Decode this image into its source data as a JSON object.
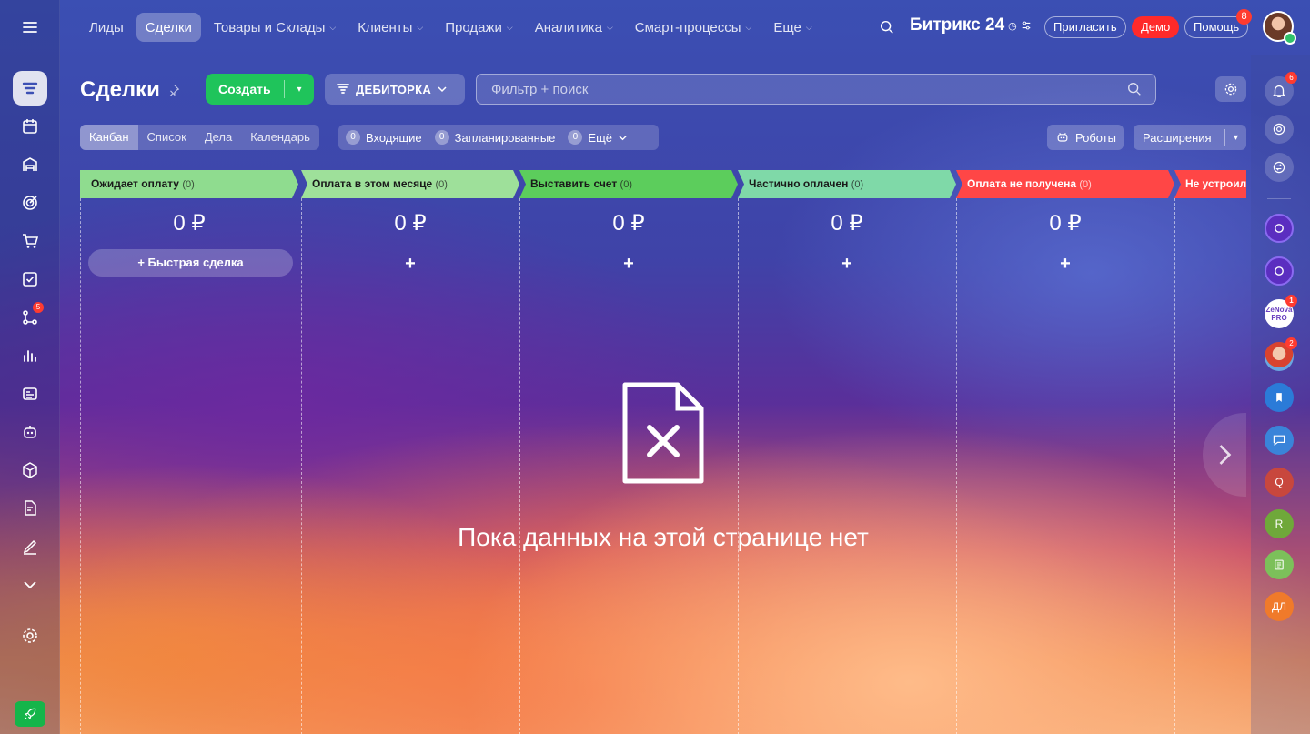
{
  "nav": {
    "items": [
      {
        "label": "Лиды",
        "dropdown": false
      },
      {
        "label": "Сделки",
        "dropdown": false,
        "active": true
      },
      {
        "label": "Товары и Склады",
        "dropdown": true
      },
      {
        "label": "Клиенты",
        "dropdown": true
      },
      {
        "label": "Продажи",
        "dropdown": true
      },
      {
        "label": "Аналитика",
        "dropdown": true
      },
      {
        "label": "Смарт-процессы",
        "dropdown": true
      },
      {
        "label": "Еще",
        "dropdown": true
      }
    ],
    "chevron": "⌵",
    "logo": "Битрикс 24",
    "invite_label": "Пригласить",
    "demo_label": "Демо",
    "help_label": "Помощь",
    "help_badge": "8"
  },
  "left_sidebar": {
    "badge_automation": "5"
  },
  "header": {
    "title": "Сделки",
    "create_label": "Создать",
    "funnel_label": "ДЕБИТОРКА",
    "search_placeholder": "Фильтр + поиск"
  },
  "view_tabs": [
    "Канбан",
    "Список",
    "Дела",
    "Календарь"
  ],
  "counters": [
    {
      "count": "0",
      "label": "Входящие"
    },
    {
      "count": "0",
      "label": "Запланированные"
    },
    {
      "count": "0",
      "label": "Ещё"
    }
  ],
  "robots_label": "Роботы",
  "extensions_label": "Расширения",
  "kanban": {
    "quick_deal_label": "Быстрая сделка",
    "plus": "+",
    "columns": [
      {
        "title": "Ожидает оплату",
        "count": "(0)",
        "sum": "0 ₽",
        "color": "#8fdc8f",
        "text_color": "#1a1a1a"
      },
      {
        "title": "Оплата в этом месяце",
        "count": "(0)",
        "sum": "0 ₽",
        "color": "#9ee09a",
        "text_color": "#1a1a1a"
      },
      {
        "title": "Выставить счет",
        "count": "(0)",
        "sum": "0 ₽",
        "color": "#5ccd5c",
        "text_color": "#1a1a1a"
      },
      {
        "title": "Частично оплачен",
        "count": "(0)",
        "sum": "0 ₽",
        "color": "#7fd9a8",
        "text_color": "#1a1a1a"
      },
      {
        "title": "Оплата не получена",
        "count": "(0)",
        "sum": "0 ₽",
        "color": "#ff4646",
        "text_color": "#ffffff"
      },
      {
        "title": "Не устроил",
        "count": "",
        "sum": "",
        "color": "#ff4646",
        "text_color": "#ffffff"
      }
    ]
  },
  "empty_state": {
    "text": "Пока данных на этой странице нет"
  },
  "right_sidebar": {
    "notifications_badge": "6",
    "items": [
      {
        "type": "icon",
        "label": ""
      },
      {
        "type": "icon",
        "label": ""
      },
      {
        "type": "avatar",
        "label": "ZeNova PRO",
        "badge": "1"
      },
      {
        "type": "avatar",
        "label": "",
        "badge": "2"
      },
      {
        "type": "icon",
        "label": ""
      },
      {
        "type": "icon",
        "label": ""
      },
      {
        "type": "letter",
        "label": "Q"
      },
      {
        "type": "letter",
        "label": "R"
      },
      {
        "type": "icon",
        "label": ""
      },
      {
        "type": "letter",
        "label": "ДЛ"
      }
    ]
  }
}
